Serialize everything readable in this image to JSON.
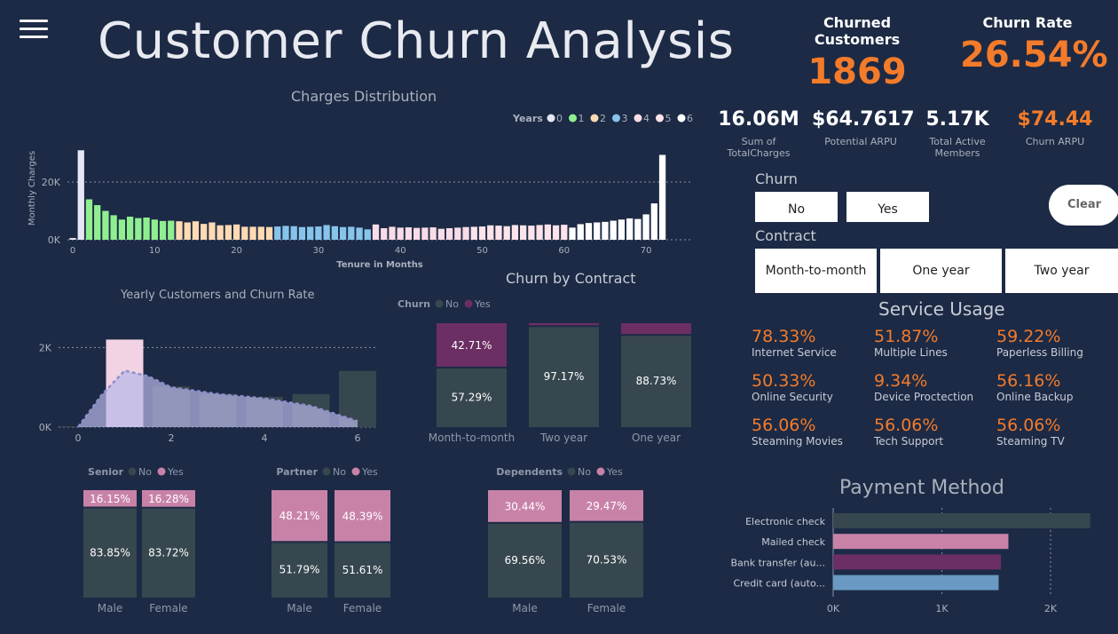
{
  "title": "Customer Churn Analysis",
  "kpis": {
    "churned_label": "Churned Customers",
    "churned_value": "1869",
    "rate_label": "Churn Rate",
    "rate_value": "26.54%"
  },
  "stats": [
    {
      "value": "16.06M",
      "label": "Sum of TotalCharges",
      "color": "#ffffff"
    },
    {
      "value": "$64.7617",
      "label": "Potential ARPU",
      "color": "#ffffff"
    },
    {
      "value": "5.17K",
      "label": "Total Active Members",
      "color": "#ffffff"
    },
    {
      "value": "$74.44",
      "label": "Churn ARPU",
      "color": "#f47b2a"
    }
  ],
  "churn_slicer": {
    "label": "Churn",
    "options": [
      "No",
      "Yes"
    ],
    "clear": "Clear"
  },
  "contract_slicer": {
    "label": "Contract",
    "options": [
      "Month-to-month",
      "One year",
      "Two year"
    ]
  },
  "service_usage": {
    "title": "Service Usage",
    "items": [
      {
        "value": "78.33%",
        "label": "Internet Service"
      },
      {
        "value": "51.87%",
        "label": "Multiple Lines"
      },
      {
        "value": "59.22%",
        "label": "Paperless Billing"
      },
      {
        "value": "50.33%",
        "label": "Online Security"
      },
      {
        "value": "9.34%",
        "label": "Device Proctection"
      },
      {
        "value": "56.16%",
        "label": "Online Backup"
      },
      {
        "value": "56.06%",
        "label": "Steaming Movies"
      },
      {
        "value": "56.06%",
        "label": "Tech Support"
      },
      {
        "value": "56.06%",
        "label": "Steaming TV"
      }
    ]
  },
  "colors": {
    "bg": "#1c2a45",
    "accent": "#f47b2a",
    "no": "#37474f",
    "yes_purple": "#6b2f64",
    "yes_pink": "#c882a8",
    "years": [
      "#e8e6f5",
      "#90ee90",
      "#ffdab3",
      "#87c4ec",
      "#f8dce6",
      "#fde3ea",
      "#ffffff"
    ]
  },
  "chart_data": [
    {
      "id": "charges",
      "type": "bar",
      "title": "Charges Distribution",
      "xlabel": "Tenure in Months",
      "ylabel": "Monthly Charges",
      "legend_title": "Years",
      "legend": [
        "0",
        "1",
        "2",
        "3",
        "4",
        "5",
        "6"
      ],
      "x_ticks": [
        "0",
        "10",
        "20",
        "30",
        "40",
        "50",
        "60",
        "70"
      ],
      "y_ticks": [
        "0K",
        "20K"
      ],
      "ylim": [
        0,
        32000
      ],
      "x": [
        0,
        1,
        2,
        3,
        4,
        5,
        6,
        7,
        8,
        9,
        10,
        11,
        12,
        13,
        14,
        15,
        16,
        17,
        18,
        19,
        20,
        21,
        22,
        23,
        24,
        25,
        26,
        27,
        28,
        29,
        30,
        31,
        32,
        33,
        34,
        35,
        36,
        37,
        38,
        39,
        40,
        41,
        42,
        43,
        44,
        45,
        46,
        47,
        48,
        49,
        50,
        51,
        52,
        53,
        54,
        55,
        56,
        57,
        58,
        59,
        60,
        61,
        62,
        63,
        64,
        65,
        66,
        67,
        68,
        69,
        70,
        71,
        72
      ],
      "values": [
        600,
        31000,
        14000,
        12000,
        10000,
        8500,
        7000,
        8000,
        7500,
        7700,
        7000,
        6500,
        6600,
        6400,
        6000,
        6400,
        5500,
        6000,
        5000,
        5100,
        5300,
        4500,
        4500,
        4500,
        4400,
        4600,
        4800,
        4700,
        4400,
        4500,
        4600,
        5100,
        4700,
        4400,
        4500,
        4200,
        3600,
        5300,
        4000,
        4500,
        4200,
        4300,
        4100,
        4200,
        4300,
        3800,
        4000,
        4200,
        4400,
        4500,
        4600,
        5000,
        4900,
        4700,
        5100,
        5000,
        4900,
        5100,
        5300,
        5000,
        5200,
        4200,
        5400,
        5800,
        6000,
        6200,
        6600,
        7000,
        7400,
        7200,
        8800,
        12600,
        29400
      ],
      "series_year": [
        0,
        0,
        1,
        1,
        1,
        1,
        1,
        1,
        1,
        1,
        1,
        1,
        1,
        2,
        2,
        2,
        2,
        2,
        2,
        2,
        2,
        2,
        2,
        2,
        2,
        3,
        3,
        3,
        3,
        3,
        3,
        3,
        3,
        3,
        3,
        3,
        3,
        4,
        4,
        4,
        4,
        4,
        4,
        4,
        4,
        4,
        4,
        4,
        4,
        5,
        5,
        5,
        5,
        5,
        5,
        5,
        5,
        5,
        5,
        5,
        5,
        6,
        6,
        6,
        6,
        6,
        6,
        6,
        6,
        6,
        6,
        6,
        6
      ]
    },
    {
      "id": "yearly",
      "type": "bar",
      "title": "Yearly Customers and Churn Rate",
      "categories": [
        "0",
        "1",
        "2",
        "3",
        "4",
        "5",
        "6"
      ],
      "x_ticks": [
        "0",
        "2",
        "4",
        "6"
      ],
      "y_ticks": [
        "0K",
        "2K"
      ],
      "ylim": [
        0,
        2700
      ],
      "values": [
        20,
        2200,
        1020,
        830,
        760,
        830,
        1410
      ],
      "line": [
        {
          "x": 0,
          "y": 0
        },
        {
          "x": 0.5,
          "y": 800
        },
        {
          "x": 1,
          "y": 1420
        },
        {
          "x": 1.5,
          "y": 1280
        },
        {
          "x": 2,
          "y": 1000
        },
        {
          "x": 3,
          "y": 830
        },
        {
          "x": 4,
          "y": 720
        },
        {
          "x": 5,
          "y": 530
        },
        {
          "x": 6,
          "y": 150
        }
      ]
    },
    {
      "id": "contract",
      "type": "bar",
      "title": "Churn by Contract",
      "legend_title": "Churn",
      "legend": [
        "No",
        "Yes"
      ],
      "categories": [
        "Month-to-month",
        "Two year",
        "One year"
      ],
      "series": [
        {
          "name": "No",
          "values": [
            57.29,
            97.17,
            88.73
          ],
          "labels": [
            "57.29%",
            "97.17%",
            "88.73%"
          ]
        },
        {
          "name": "Yes",
          "values": [
            42.71,
            2.83,
            11.27
          ],
          "labels": [
            "42.71%",
            "",
            ""
          ]
        }
      ]
    },
    {
      "id": "senior",
      "type": "bar",
      "legend_title": "Senior",
      "legend": [
        "No",
        "Yes"
      ],
      "categories": [
        "Male",
        "Female"
      ],
      "series": [
        {
          "name": "No",
          "values": [
            83.85,
            83.72
          ],
          "labels": [
            "83.85%",
            "83.72%"
          ]
        },
        {
          "name": "Yes",
          "values": [
            16.15,
            16.28
          ],
          "labels": [
            "16.15%",
            "16.28%"
          ]
        }
      ]
    },
    {
      "id": "partner",
      "type": "bar",
      "legend_title": "Partner",
      "legend": [
        "No",
        "Yes"
      ],
      "categories": [
        "Male",
        "Female"
      ],
      "series": [
        {
          "name": "No",
          "values": [
            51.79,
            51.61
          ],
          "labels": [
            "51.79%",
            "51.61%"
          ]
        },
        {
          "name": "Yes",
          "values": [
            48.21,
            48.39
          ],
          "labels": [
            "48.21%",
            "48.39%"
          ]
        }
      ]
    },
    {
      "id": "dependents",
      "type": "bar",
      "legend_title": "Dependents",
      "legend": [
        "No",
        "Yes"
      ],
      "categories": [
        "Male",
        "Female"
      ],
      "series": [
        {
          "name": "No",
          "values": [
            69.56,
            70.53
          ],
          "labels": [
            "69.56%",
            "70.53%"
          ]
        },
        {
          "name": "Yes",
          "values": [
            30.44,
            29.47
          ],
          "labels": [
            "30.44%",
            "29.47%"
          ]
        }
      ]
    },
    {
      "id": "payment",
      "type": "bar",
      "orientation": "horizontal",
      "title": "Payment Method",
      "categories": [
        "Electronic check",
        "Mailed check",
        "Bank transfer (au...",
        "Credit card (auto..."
      ],
      "values": [
        2365,
        1612,
        1544,
        1522
      ],
      "colors": [
        "#37474f",
        "#c882a8",
        "#6b2f64",
        "#6a9ac4"
      ],
      "x_ticks": [
        "0K",
        "1K",
        "2K"
      ],
      "xlim": [
        0,
        2400
      ]
    }
  ]
}
